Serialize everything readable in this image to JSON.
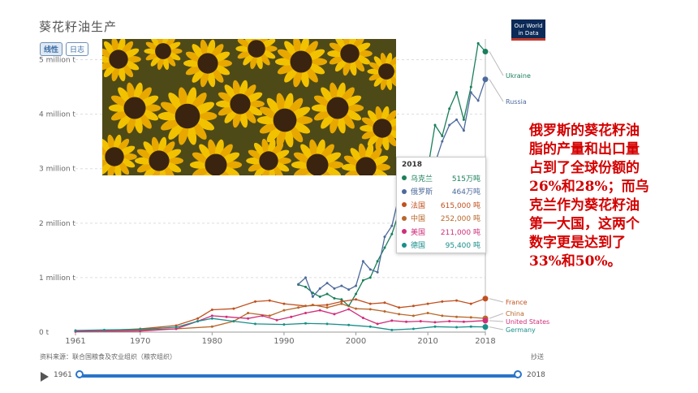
{
  "title": "葵花籽油生产",
  "toggle": {
    "linear": "线性",
    "log": "日志"
  },
  "logo": {
    "line1": "Our World",
    "line2": "in Data"
  },
  "tooltip": {
    "year": "2018",
    "rows": [
      {
        "name": "乌克兰",
        "value": "515万吨",
        "color": "#1a7f5a"
      },
      {
        "name": "俄罗斯",
        "value": "464万吨",
        "color": "#4c6a9c"
      },
      {
        "name": "法国",
        "value": "615,000 吨",
        "color": "#c0501f"
      },
      {
        "name": "中国",
        "value": "252,000 吨",
        "color": "#b8672a"
      },
      {
        "name": "美国",
        "value": "211,000 吨",
        "color": "#cf2e7a"
      },
      {
        "name": "德国",
        "value": "95,400 吨",
        "color": "#1a8f8a"
      }
    ]
  },
  "annotation": {
    "lines": [
      "俄罗斯的葵花籽油",
      "脂的产量和出口量",
      "占到了全球份额的",
      "26%和28%；而乌",
      "克兰作为葵花籽油",
      "第一大国，这两个",
      "数字更是达到了",
      "33%和50%。"
    ]
  },
  "source": "资料来源：联合国粮食及农业组织（粮农组织）",
  "share": "抄送",
  "timeline": {
    "start": "1961",
    "end": "2018"
  },
  "chart_data": {
    "type": "line",
    "ylim": [
      0,
      5500000
    ],
    "xlim": [
      1961,
      2018
    ],
    "yticks": [
      {
        "v": 0,
        "label": "0 t"
      },
      {
        "v": 1000000,
        "label": "1 million t"
      },
      {
        "v": 2000000,
        "label": "2 million t"
      },
      {
        "v": 3000000,
        "label": "3 million t"
      },
      {
        "v": 4000000,
        "label": "4 million t"
      },
      {
        "v": 5000000,
        "label": "5 million t"
      }
    ],
    "xticks": [
      "1961",
      "1970",
      "1980",
      "1990",
      "2000",
      "2010",
      "2018"
    ],
    "series": [
      {
        "name": "Ukraine",
        "color": "#1a7f5a",
        "points": [
          [
            1992,
            870000
          ],
          [
            1993,
            830000
          ],
          [
            1994,
            720000
          ],
          [
            1995,
            650000
          ],
          [
            1996,
            700000
          ],
          [
            1997,
            620000
          ],
          [
            1998,
            600000
          ],
          [
            1999,
            480000
          ],
          [
            2000,
            700000
          ],
          [
            2001,
            950000
          ],
          [
            2002,
            1000000
          ],
          [
            2003,
            1300000
          ],
          [
            2004,
            1550000
          ],
          [
            2005,
            1800000
          ],
          [
            2006,
            2200000
          ],
          [
            2007,
            1900000
          ],
          [
            2008,
            2600000
          ],
          [
            2009,
            3050000
          ],
          [
            2010,
            3000000
          ],
          [
            2011,
            3800000
          ],
          [
            2012,
            3600000
          ],
          [
            2013,
            4100000
          ],
          [
            2014,
            4400000
          ],
          [
            2015,
            3900000
          ],
          [
            2016,
            4500000
          ],
          [
            2017,
            5300000
          ],
          [
            2018,
            5150000
          ]
        ]
      },
      {
        "name": "Russia",
        "color": "#4c6a9c",
        "points": [
          [
            1992,
            880000
          ],
          [
            1993,
            1000000
          ],
          [
            1994,
            650000
          ],
          [
            1995,
            800000
          ],
          [
            1996,
            900000
          ],
          [
            1997,
            800000
          ],
          [
            1998,
            850000
          ],
          [
            1999,
            780000
          ],
          [
            2000,
            850000
          ],
          [
            2001,
            1300000
          ],
          [
            2002,
            1150000
          ],
          [
            2003,
            1100000
          ],
          [
            2004,
            1750000
          ],
          [
            2005,
            1950000
          ],
          [
            2006,
            2500000
          ],
          [
            2007,
            2400000
          ],
          [
            2008,
            2550000
          ],
          [
            2009,
            2850000
          ],
          [
            2010,
            2300000
          ],
          [
            2011,
            3100000
          ],
          [
            2012,
            3500000
          ],
          [
            2013,
            3800000
          ],
          [
            2014,
            3900000
          ],
          [
            2015,
            3700000
          ],
          [
            2016,
            4400000
          ],
          [
            2017,
            4250000
          ],
          [
            2018,
            4640000
          ]
        ]
      },
      {
        "name": "France",
        "color": "#c0501f",
        "points": [
          [
            1961,
            20000
          ],
          [
            1965,
            30000
          ],
          [
            1970,
            60000
          ],
          [
            1975,
            120000
          ],
          [
            1978,
            250000
          ],
          [
            1980,
            410000
          ],
          [
            1983,
            430000
          ],
          [
            1986,
            560000
          ],
          [
            1988,
            580000
          ],
          [
            1990,
            520000
          ],
          [
            1993,
            480000
          ],
          [
            1996,
            500000
          ],
          [
            1998,
            560000
          ],
          [
            2000,
            600000
          ],
          [
            2002,
            520000
          ],
          [
            2004,
            540000
          ],
          [
            2006,
            450000
          ],
          [
            2008,
            480000
          ],
          [
            2010,
            520000
          ],
          [
            2012,
            560000
          ],
          [
            2014,
            580000
          ],
          [
            2016,
            520000
          ],
          [
            2018,
            615000
          ]
        ]
      },
      {
        "name": "China",
        "color": "#b8672a",
        "points": [
          [
            1961,
            20000
          ],
          [
            1970,
            40000
          ],
          [
            1975,
            60000
          ],
          [
            1980,
            100000
          ],
          [
            1983,
            200000
          ],
          [
            1985,
            350000
          ],
          [
            1988,
            300000
          ],
          [
            1990,
            400000
          ],
          [
            1992,
            450000
          ],
          [
            1994,
            500000
          ],
          [
            1996,
            450000
          ],
          [
            1998,
            520000
          ],
          [
            2000,
            430000
          ],
          [
            2002,
            420000
          ],
          [
            2004,
            380000
          ],
          [
            2006,
            330000
          ],
          [
            2008,
            300000
          ],
          [
            2010,
            350000
          ],
          [
            2012,
            300000
          ],
          [
            2014,
            280000
          ],
          [
            2016,
            270000
          ],
          [
            2018,
            252000
          ]
        ]
      },
      {
        "name": "United States",
        "color": "#cf2e7a",
        "points": [
          [
            1961,
            10000
          ],
          [
            1970,
            20000
          ],
          [
            1975,
            60000
          ],
          [
            1978,
            200000
          ],
          [
            1980,
            300000
          ],
          [
            1982,
            280000
          ],
          [
            1985,
            250000
          ],
          [
            1987,
            300000
          ],
          [
            1989,
            220000
          ],
          [
            1991,
            280000
          ],
          [
            1993,
            350000
          ],
          [
            1995,
            400000
          ],
          [
            1997,
            330000
          ],
          [
            1999,
            420000
          ],
          [
            2001,
            260000
          ],
          [
            2003,
            150000
          ],
          [
            2005,
            210000
          ],
          [
            2007,
            190000
          ],
          [
            2009,
            200000
          ],
          [
            2011,
            180000
          ],
          [
            2013,
            200000
          ],
          [
            2015,
            190000
          ],
          [
            2018,
            211000
          ]
        ]
      },
      {
        "name": "Germany",
        "color": "#1a8f8a",
        "points": [
          [
            1961,
            30000
          ],
          [
            1965,
            40000
          ],
          [
            1970,
            50000
          ],
          [
            1975,
            90000
          ],
          [
            1978,
            200000
          ],
          [
            1980,
            250000
          ],
          [
            1983,
            200000
          ],
          [
            1986,
            150000
          ],
          [
            1990,
            140000
          ],
          [
            1993,
            160000
          ],
          [
            1996,
            150000
          ],
          [
            1999,
            130000
          ],
          [
            2002,
            100000
          ],
          [
            2005,
            40000
          ],
          [
            2008,
            60000
          ],
          [
            2011,
            100000
          ],
          [
            2014,
            90000
          ],
          [
            2016,
            100000
          ],
          [
            2018,
            95400
          ]
        ]
      }
    ],
    "legend_labels": [
      "Ukraine",
      "Russia",
      "France",
      "China",
      "United States",
      "Germany"
    ]
  }
}
